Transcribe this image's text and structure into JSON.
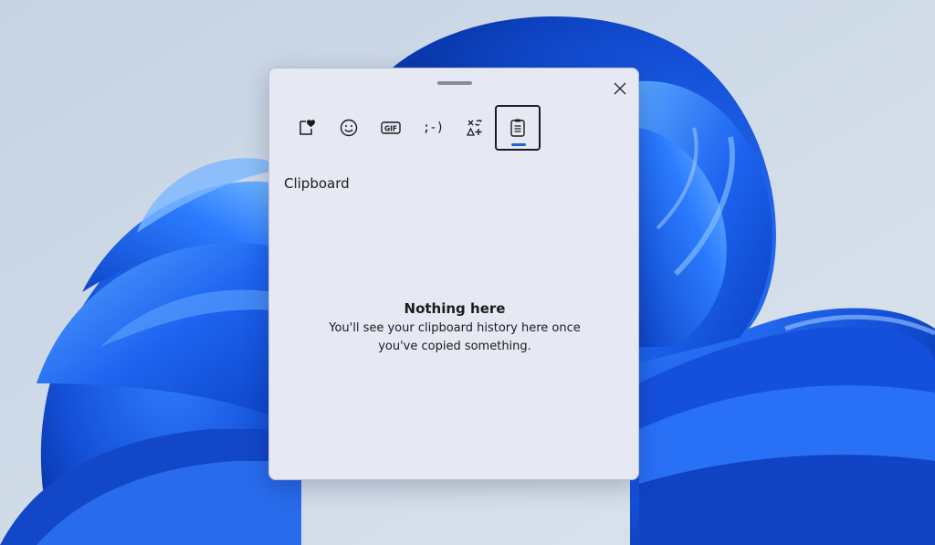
{
  "panel": {
    "close_icon": "close-icon",
    "tabs": [
      {
        "name": "favorites",
        "icon": "heart-note-icon",
        "active": false
      },
      {
        "name": "emoji",
        "icon": "smiley-icon",
        "active": false
      },
      {
        "name": "gif",
        "icon": "gif-icon",
        "label": "GIF",
        "active": false
      },
      {
        "name": "kaomoji",
        "icon": "kaomoji-icon",
        "label": ";-)",
        "active": false
      },
      {
        "name": "symbols",
        "icon": "symbols-icon",
        "active": false
      },
      {
        "name": "clipboard",
        "icon": "clipboard-icon",
        "active": true
      }
    ],
    "section_title": "Clipboard",
    "empty_title": "Nothing here",
    "empty_message": "You'll see your clipboard history here once you've copied something."
  },
  "colors": {
    "accent": "#1f66c9",
    "panel_bg": "#e6e9f3",
    "wallpaper_bg": "#cfd9e6",
    "wallpaper_bloom": "#1a5ee8"
  }
}
